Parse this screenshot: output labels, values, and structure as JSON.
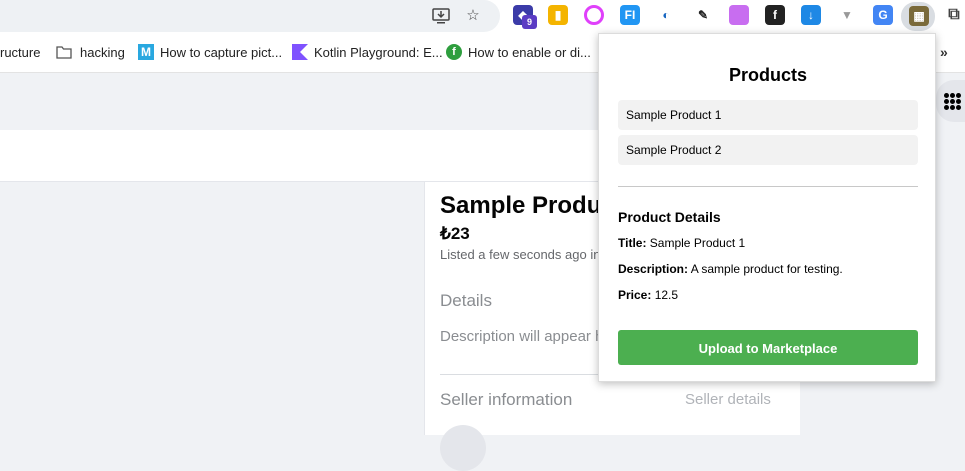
{
  "browser": {
    "toolbar_icons": [
      "install-icon",
      "star-icon"
    ],
    "extension_badge": "9",
    "extensions": [
      "extension-puzzle-icon"
    ],
    "bookmarks": [
      {
        "label": "ructure",
        "icon": "none"
      },
      {
        "label": "hacking",
        "icon": "folder-icon"
      },
      {
        "label": "How to capture pict...",
        "icon": "m-logo-icon"
      },
      {
        "label": "Kotlin Playground: E...",
        "icon": "kotlin-icon"
      },
      {
        "label": "How to enable or di...",
        "icon": "green-f-icon"
      }
    ],
    "bookmarks_more": "»"
  },
  "page": {
    "product_title": "Sample Produ",
    "product_price": "₺23",
    "listed_text": "Listed a few seconds ago in",
    "details_heading": "Details",
    "description_placeholder": "Description will appear h",
    "seller_heading": "Seller information",
    "seller_details_link": "Seller details"
  },
  "popup": {
    "title": "Products",
    "products": [
      "Sample Product 1",
      "Sample Product 2"
    ],
    "details_heading": "Product Details",
    "title_label": "Title:",
    "title_value": "Sample Product 1",
    "description_label": "Description:",
    "description_value": "A sample product for testing.",
    "price_label": "Price:",
    "price_value": "12.5",
    "upload_label": "Upload to Marketplace"
  },
  "colors": {
    "upload_button": "#4caf50",
    "extension_badge": "#5b3cc4"
  }
}
